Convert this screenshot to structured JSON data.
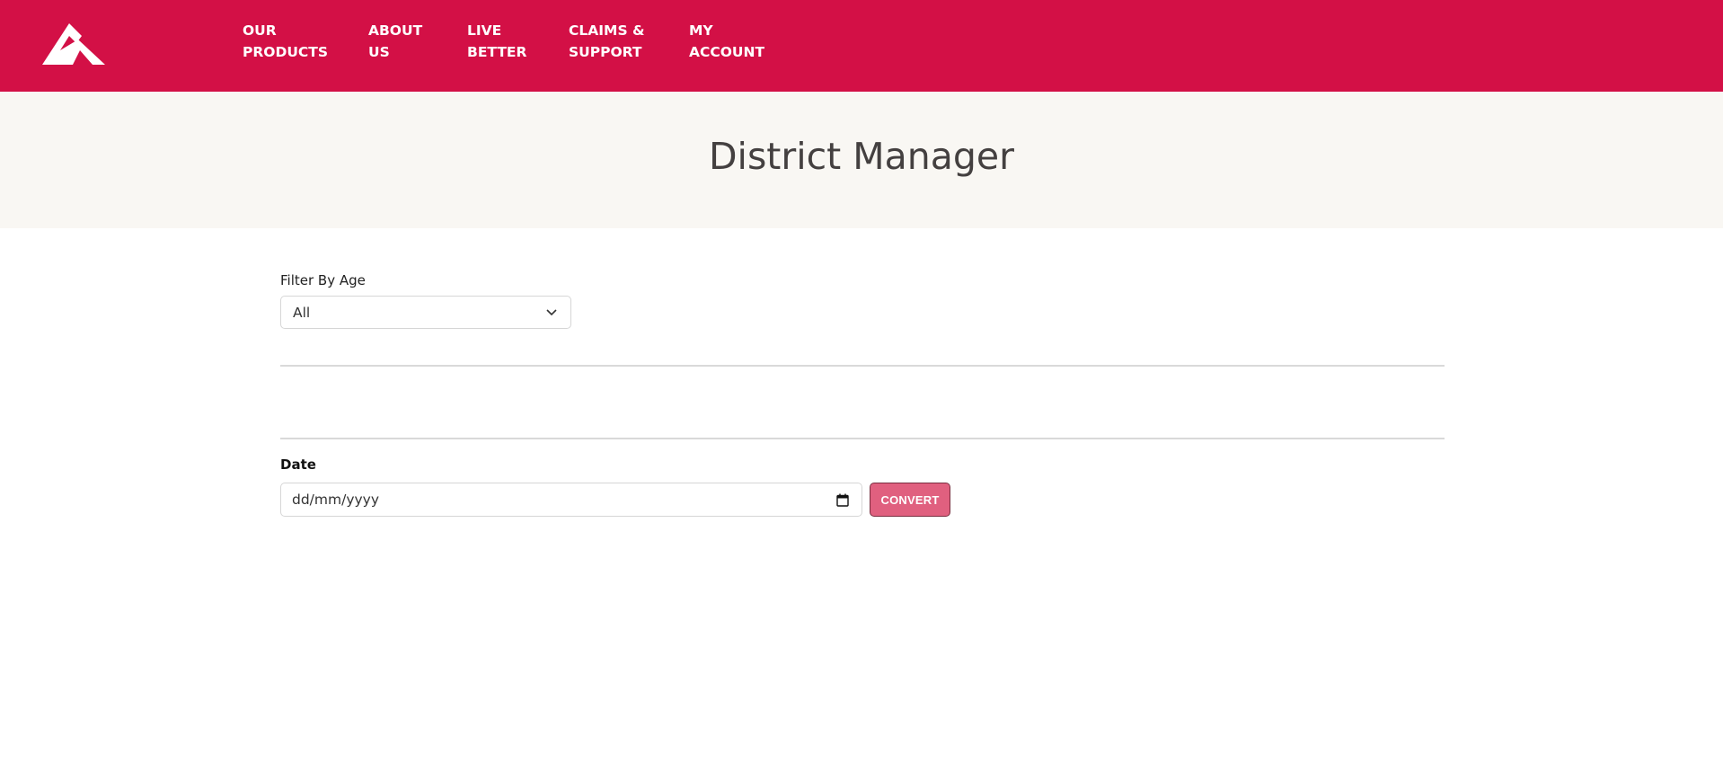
{
  "header": {
    "logo_icon": "mountain-logo-icon",
    "nav": [
      {
        "line1": "OUR",
        "line2": "PRODUCTS"
      },
      {
        "line1": "ABOUT",
        "line2": "US"
      },
      {
        "line1": "LIVE",
        "line2": "BETTER"
      },
      {
        "line1": "CLAIMS &",
        "line2": "SUPPORT"
      },
      {
        "line1": "MY",
        "line2": "ACCOUNT"
      }
    ]
  },
  "hero": {
    "title": "District Manager"
  },
  "filter": {
    "label": "Filter By Age",
    "selected": "All",
    "icon": "chevron-down-icon"
  },
  "date": {
    "label": "Date",
    "placeholder": "dd/mm/yyyy",
    "icon": "calendar-icon"
  },
  "convert": {
    "label": "CONVERT"
  },
  "colors": {
    "brand": "#d31046",
    "hero_bg": "#f9f7f3",
    "button": "#e0607f"
  }
}
